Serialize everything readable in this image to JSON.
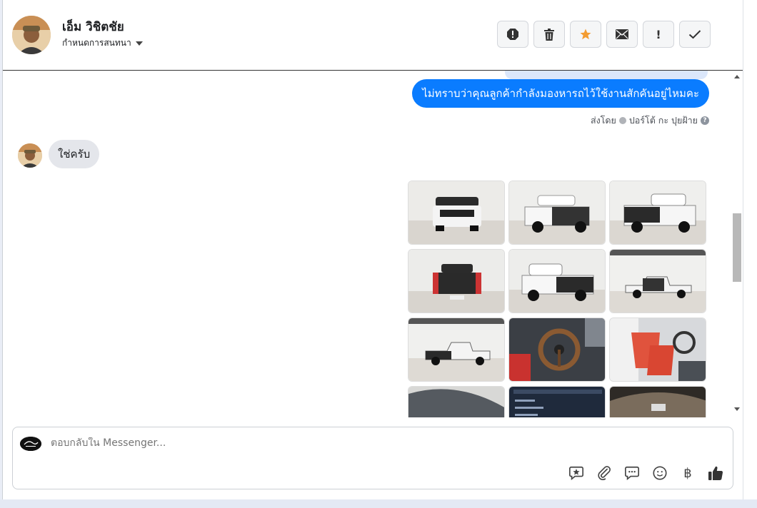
{
  "header": {
    "contact_name": "เอ็ม วิชิตชัย",
    "assign_label": "กำหนดการสนทนา",
    "actions": [
      {
        "name": "report-icon",
        "label": "report"
      },
      {
        "name": "trash-icon",
        "label": "delete"
      },
      {
        "name": "star-icon",
        "label": "star"
      },
      {
        "name": "envelope-icon",
        "label": "mark unread"
      },
      {
        "name": "exclamation-icon",
        "label": "!"
      },
      {
        "name": "check-icon",
        "label": "done"
      }
    ]
  },
  "messages": {
    "outgoing_text": "ไม่ทราบว่าคุณลูกค้ากำลังมองหารถไว้ใช้งานสักคันอยู่ไหมคะ",
    "sent_by_label": "ส่งโดย",
    "sent_by_name": "ปอร์โต้ กะ ปุยฝ้าย",
    "help_glyph": "?",
    "incoming_text": "ใช่ครับ",
    "photos": [
      "truck-front",
      "truck-front-left",
      "truck-rear-right",
      "truck-rear",
      "truck-rear-left",
      "truck-side-right",
      "truck-side-left",
      "interior-steering",
      "interior-seats",
      "wheel-closeup",
      "document-screen",
      "dashboard-gauges"
    ]
  },
  "composer": {
    "placeholder": "ตอบกลับใน Messenger...",
    "tools": [
      "star-message-icon",
      "attachment-icon",
      "saved-reply-icon",
      "emoji-icon",
      "baht-icon",
      "thumbs-up-icon"
    ],
    "baht_glyph": "฿"
  },
  "colors": {
    "outgoing_bubble": "#0a7cff",
    "incoming_bubble": "#e4e6eb",
    "star": "#f39c32"
  }
}
